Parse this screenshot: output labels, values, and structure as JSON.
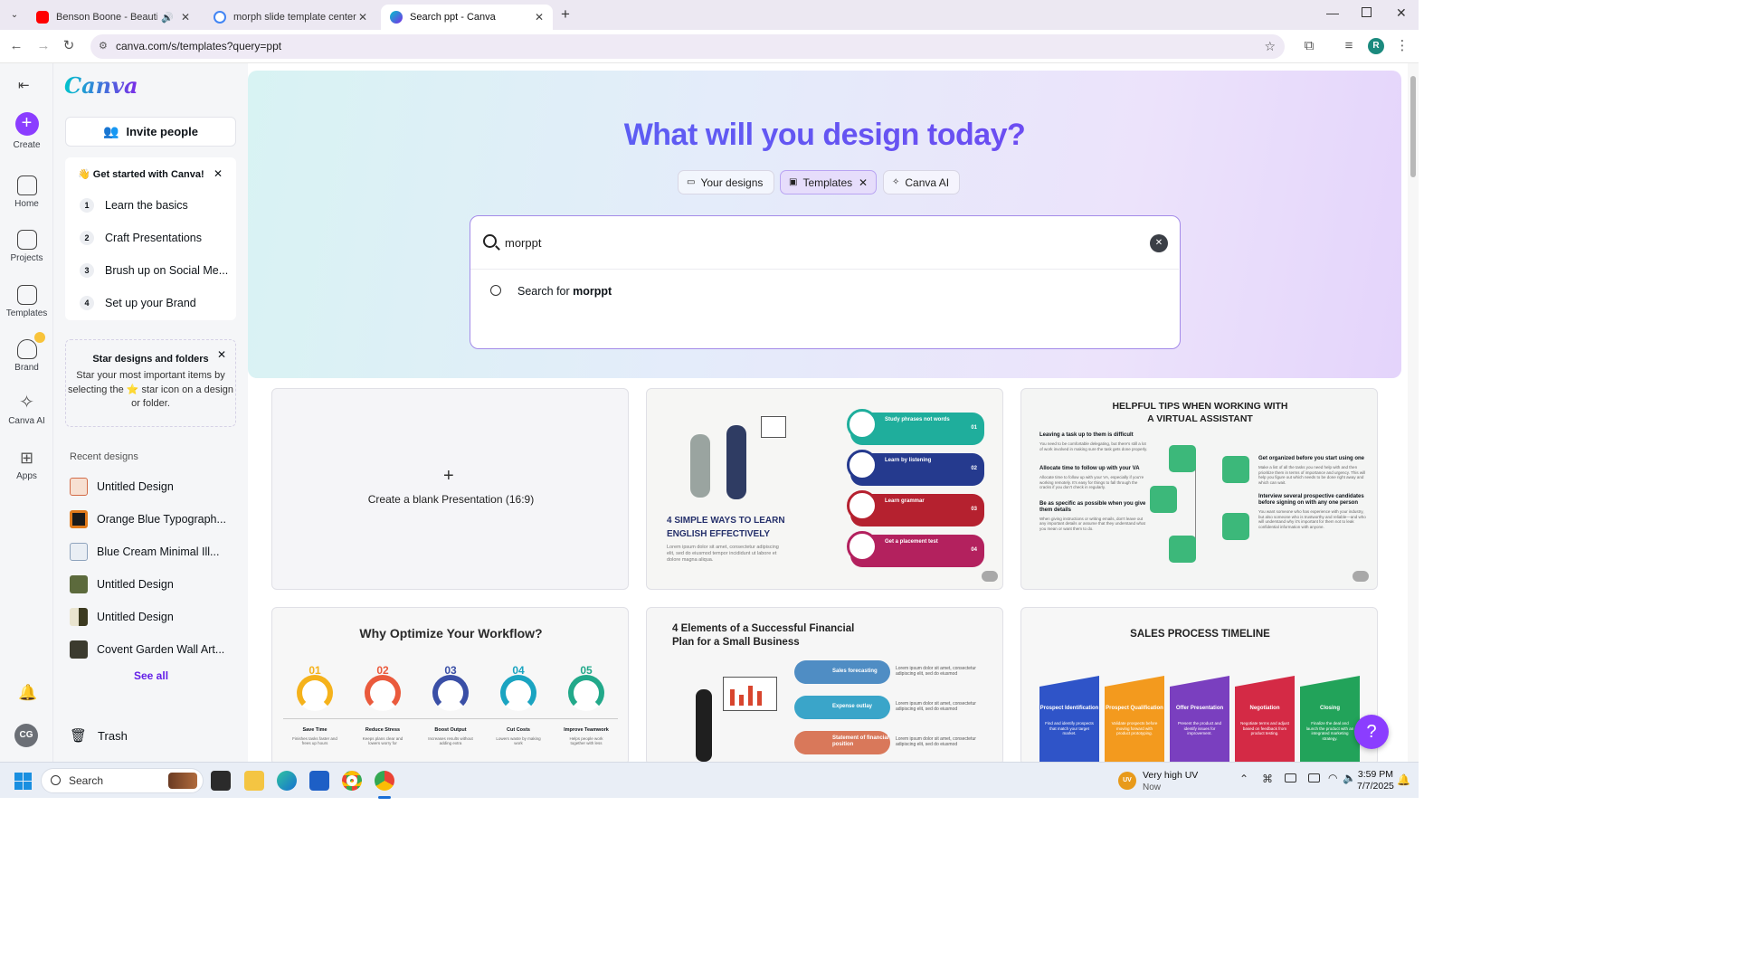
{
  "browser": {
    "tabs": [
      {
        "title": "Benson Boone - Beautiful Things"
      },
      {
        "title": "morph slide template center with"
      },
      {
        "title": "Search ppt - Canva"
      }
    ],
    "url": "canva.com/s/templates?query=ppt"
  },
  "rail": {
    "create": "Create",
    "items": [
      "Home",
      "Projects",
      "Templates",
      "Brand",
      "Canva AI",
      "Apps"
    ],
    "avatar_initials": "CG"
  },
  "sidebar": {
    "logo": "Canva",
    "invite_label": "Invite people",
    "getting_started": {
      "title": "Get started with Canva!",
      "steps": [
        {
          "num": "1",
          "label": "Learn the basics"
        },
        {
          "num": "2",
          "label": "Craft Presentations"
        },
        {
          "num": "3",
          "label": "Brush up on Social Me..."
        },
        {
          "num": "4",
          "label": "Set up your Brand"
        }
      ]
    },
    "star_tip": {
      "title": "Star designs and folders",
      "body_1": "Star your most important items by",
      "body_2": "selecting the ⭐ star icon on a design",
      "body_3": "or folder."
    },
    "recent_title": "Recent designs",
    "recent": [
      {
        "label": "Untitled Design"
      },
      {
        "label": "Orange Blue Typograph..."
      },
      {
        "label": "Blue Cream Minimal Ill..."
      },
      {
        "label": "Untitled Design"
      },
      {
        "label": "Untitled Design"
      },
      {
        "label": "Covent Garden Wall Art..."
      }
    ],
    "see_all": "See all",
    "trash": "Trash"
  },
  "hero": {
    "headline": "What will you design today?",
    "filters": [
      {
        "label": "Your designs"
      },
      {
        "label": "Templates"
      },
      {
        "label": "Canva AI"
      }
    ],
    "search_value": "morppt",
    "suggestion_prefix": "Search for ",
    "suggestion_term": "morppt"
  },
  "templates": {
    "blank_label": "Create a blank Presentation (16:9)",
    "english": {
      "title": "4 SIMPLE WAYS TO LEARN ENGLISH EFFECTIVELY",
      "body": "Lorem ipsum dolor sit amet, consectetur adipiscing elit, sed do eiusmod tempor incididunt ut labore et dolore magna aliqua.",
      "items": [
        {
          "label": "Study phrases not words",
          "num": "01",
          "color": "#1fae9c"
        },
        {
          "label": "Learn by listening",
          "num": "02",
          "color": "#253a8e"
        },
        {
          "label": "Learn grammar",
          "num": "03",
          "color": "#b5212f"
        },
        {
          "label": "Get a placement test",
          "num": "04",
          "color": "#b3215e"
        }
      ],
      "item_body": "Lorem ipsum dolor sit amet, consectetur adipiscing elit, sed do eiusmod"
    },
    "va": {
      "title": "HELPFUL TIPS WHEN WORKING WITH A VIRTUAL ASSISTANT",
      "left": [
        {
          "head": "Leaving a task up to them is difficult",
          "body": "You need to be comfortable delegating, but there's still a lot of work involved in making sure the task gets done properly."
        },
        {
          "head": "Allocate time to follow up with your VA",
          "body": "Allocate time to follow up with your VA, especially if you're working remotely. It's easy for things to fall through the cracks if you don't check in regularly."
        },
        {
          "head": "Be as specific as possible when you give them details",
          "body": "When giving instructions or writing emails, don't leave out any important details or assume that they understand what you mean or want them to do."
        }
      ],
      "right": [
        {
          "head": "Get organized before you start using one",
          "body": "Make a list of all the tasks you need help with and then prioritize them in terms of importance and urgency. This will help you figure out which needs to be done right away and which can wait."
        },
        {
          "head": "Interview several prospective candidates before signing on with any one person",
          "body": "You want someone who has experience with your industry, but also someone who is trustworthy and reliable—and who will understand why it's important for them not to leak confidential information with anyone."
        }
      ]
    },
    "workflow": {
      "title": "Why Optimize Your Workflow?",
      "steps": [
        {
          "num": "01",
          "label": "Save Time",
          "desc": "Finishes tasks faster and frees up hours",
          "color": "#f5b21b"
        },
        {
          "num": "02",
          "label": "Reduce Stress",
          "desc": "Keeps plans clear and lowers worry for",
          "color": "#ea5a3c"
        },
        {
          "num": "03",
          "label": "Boost Output",
          "desc": "Increases results without adding extra",
          "color": "#3a4fa6"
        },
        {
          "num": "04",
          "label": "Cut Costs",
          "desc": "Lowers waste by making work",
          "color": "#1aa4c1"
        },
        {
          "num": "05",
          "label": "Improve Teamwork",
          "desc": "Helps people work together with less",
          "color": "#22a98a"
        }
      ]
    },
    "financial": {
      "title": "4 Elements of a Successful Financial Plan for a Small Business",
      "items": [
        {
          "label": "Sales forecasting",
          "color": "#4f8dc4"
        },
        {
          "label": "Expense outlay",
          "color": "#3aa5c9"
        },
        {
          "label": "Statement of financial position",
          "color": "#d9785a"
        }
      ],
      "item_body": "Lorem ipsum dolor sit amet, consectetur adipiscing elit, sed do eiusmod"
    },
    "sales": {
      "title": "SALES PROCESS TIMELINE",
      "steps": [
        {
          "label": "Prospect Identification",
          "body": "Find and identify prospects that match your target market.",
          "color": "#2f54c8"
        },
        {
          "label": "Prospect Qualification",
          "body": "Validate prospects before moving forward with product prototyping.",
          "color": "#f39a1e"
        },
        {
          "label": "Offer Presentation",
          "body": "Present the product and identify issues for improvement.",
          "color": "#7a3fbf"
        },
        {
          "label": "Negotiation",
          "body": "Negotiate terms and adjust based on feedback from product testing.",
          "color": "#d42a45"
        },
        {
          "label": "Closing",
          "body": "Finalize the deal and launch the product with an integrated marketing strategy.",
          "color": "#22a35a"
        }
      ]
    }
  },
  "help_label": "?",
  "taskbar": {
    "search_placeholder": "Search",
    "weather_badge": "UV",
    "weather_title": "Very high UV",
    "weather_sub": "Now",
    "time": "3:59 PM",
    "date": "7/7/2025"
  },
  "colors": {
    "accent": "#8b3dff",
    "headline_start": "#4f6df5",
    "headline_end": "#7a3df0",
    "youtube_red": "#ff0000"
  }
}
